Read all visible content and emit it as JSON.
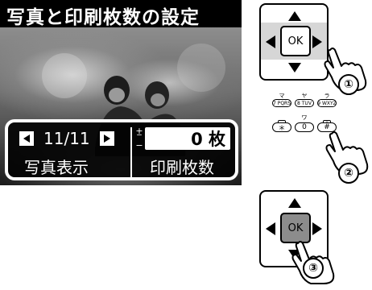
{
  "screen": {
    "title": "写真と印刷枚数の設定",
    "photo_counter": "11/11",
    "label_photo": "写真表示",
    "copies_value": "0 枚",
    "label_copies": "印刷枚数",
    "plus_minus_icon": "plus-minus-icon"
  },
  "steps": [
    {
      "number": "①",
      "action": "right-arrow"
    },
    {
      "number": "②",
      "action": "plus-key"
    },
    {
      "number": "③",
      "action": "ok-button"
    }
  ],
  "dpad": {
    "ok_label": "OK"
  },
  "keypad": {
    "kana": [
      "マ",
      "ヤ",
      "ラ"
    ],
    "row1": [
      "7 PQRS",
      "8 TUV",
      "9 WXYZ"
    ],
    "row2": [
      "＊",
      "0",
      "#"
    ],
    "row2_kana": [
      "",
      "ワ",
      ""
    ],
    "minus_symbol": "−",
    "plus_symbol": "+"
  },
  "colors": {
    "pressed_ok": "#8c8c8c",
    "screen_bg": "#000000"
  }
}
